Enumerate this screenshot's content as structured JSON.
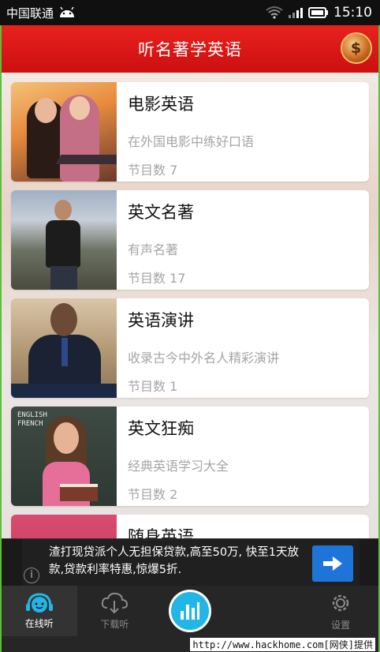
{
  "status_bar": {
    "carrier": "中国联通",
    "time": "15:10"
  },
  "header": {
    "title": "听名著学英语",
    "coin_icon": "dollar-coin-icon"
  },
  "cards": [
    {
      "title": "电影英语",
      "desc": "在外国电影中练好口语",
      "count": "节目数 7"
    },
    {
      "title": "英文名著",
      "desc": "有声名著",
      "count": "节目数 17"
    },
    {
      "title": "英语演讲",
      "desc": "收录古今中外名人精彩演讲",
      "count": "节目数 1"
    },
    {
      "title": "英文狂痴",
      "desc": "经典英语学习大全",
      "count": "节目数 2"
    },
    {
      "title": "随身英语",
      "desc": "",
      "count": ""
    }
  ],
  "thumb4_chalk": "ENGLISH\nFRENCH",
  "ad": {
    "text": "渣打现贷派个人无担保贷款,高至50万, 快至1天放款,贷款利率特惠,惊爆5折.",
    "info": "i"
  },
  "nav": {
    "online": "在线听",
    "download": "下载听",
    "settings": "设置"
  },
  "watermark": "http://www.hackhome.com[网侠]提供",
  "colors": {
    "header_red": "#d9191a",
    "accent_blue": "#22b6e6",
    "ad_blue": "#1e74d8"
  }
}
